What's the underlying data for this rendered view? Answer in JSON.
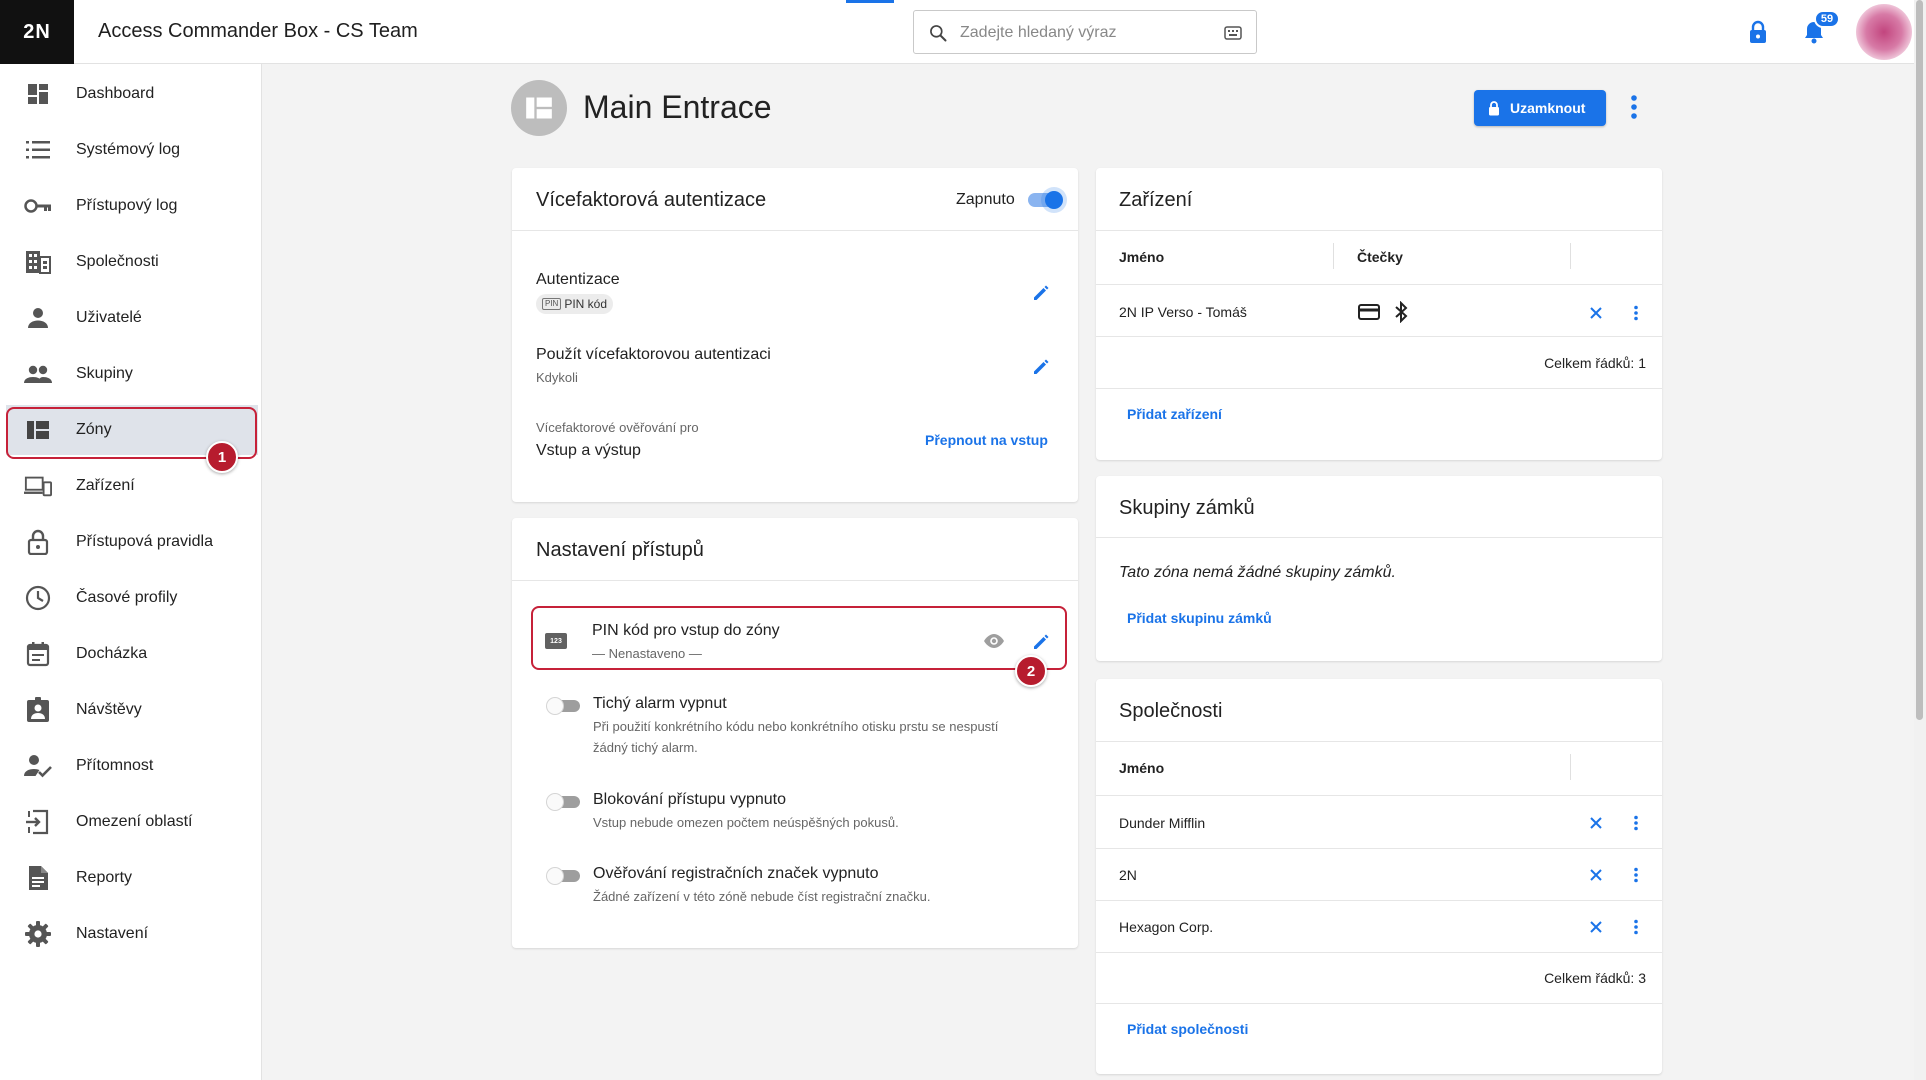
{
  "app": {
    "logo": "2N",
    "title": "Access Commander Box - CS Team"
  },
  "search": {
    "placeholder": "Zadejte hledaný výraz"
  },
  "notifications": {
    "count": "59"
  },
  "colors": {
    "accent": "#1a73e8",
    "highlight": "#c62139"
  },
  "sidebar": {
    "items": [
      {
        "label": "Dashboard",
        "icon": "dashboard-icon"
      },
      {
        "label": "Systémový log",
        "icon": "list-icon"
      },
      {
        "label": "Přístupový log",
        "icon": "key-icon"
      },
      {
        "label": "Společnosti",
        "icon": "building-icon"
      },
      {
        "label": "Uživatelé",
        "icon": "person-icon"
      },
      {
        "label": "Skupiny",
        "icon": "people-icon"
      },
      {
        "label": "Zóny",
        "icon": "zones-icon",
        "active": true
      },
      {
        "label": "Zařízení",
        "icon": "devices-icon"
      },
      {
        "label": "Přístupová pravidla",
        "icon": "lock-icon"
      },
      {
        "label": "Časové profily",
        "icon": "clock-icon"
      },
      {
        "label": "Docházka",
        "icon": "calendar-icon"
      },
      {
        "label": "Návštěvy",
        "icon": "visitor-icon"
      },
      {
        "label": "Přítomnost",
        "icon": "presence-icon"
      },
      {
        "label": "Omezení oblastí",
        "icon": "area-limit-icon"
      },
      {
        "label": "Reporty",
        "icon": "report-icon"
      },
      {
        "label": "Nastavení",
        "icon": "gear-icon"
      }
    ]
  },
  "markers": {
    "one": "1",
    "two": "2"
  },
  "page": {
    "title": "Main Entrace",
    "lock_label": "Uzamknout"
  },
  "mfa": {
    "title": "Vícefaktorová autentizace",
    "toggle_label": "Zapnuto",
    "toggle_on": true,
    "auth_label": "Autentizace",
    "auth_chip_icon": "PIN",
    "auth_chip": "PIN kód",
    "use_label": "Použít vícefaktorovou autentizaci",
    "use_value": "Kdykoli",
    "verify_label": "Vícefaktorové ověřování pro",
    "verify_value": "Vstup a výstup",
    "switch_link": "Přepnout na vstup"
  },
  "access": {
    "title": "Nastavení přístupů",
    "pin_icon": "123",
    "pin_title": "PIN kód pro vstup do zóny",
    "pin_value": "— Nenastaveno —",
    "silent_alarm": {
      "title": "Tichý alarm vypnut",
      "desc1": "Při použití konkrétního kódu nebo konkrétního otisku prstu se nespustí",
      "desc2": "žádný tichý alarm."
    },
    "blocking": {
      "title": "Blokování přístupu vypnuto",
      "desc": "Vstup nebude omezen počtem neúspěšných pokusů."
    },
    "plates": {
      "title": "Ověřování registračních značek vypnuto",
      "desc": "Žádné zařízení v této zóně nebude číst registrační značku."
    }
  },
  "devices": {
    "title": "Zařízení",
    "col_name": "Jméno",
    "col_readers": "Čtečky",
    "rows": [
      {
        "name": "2N IP Verso - Tomáš"
      }
    ],
    "total": "Celkem řádků: 1",
    "add": "Přidat zařízení"
  },
  "lock_groups": {
    "title": "Skupiny zámků",
    "empty": "Tato zóna nemá žádné skupiny zámků.",
    "add": "Přidat skupinu zámků"
  },
  "companies": {
    "title": "Společnosti",
    "col_name": "Jméno",
    "rows": [
      {
        "name": "Dunder Mifflin"
      },
      {
        "name": "2N"
      },
      {
        "name": "Hexagon Corp."
      }
    ],
    "total": "Celkem řádků: 3",
    "add": "Přidat společnosti"
  }
}
